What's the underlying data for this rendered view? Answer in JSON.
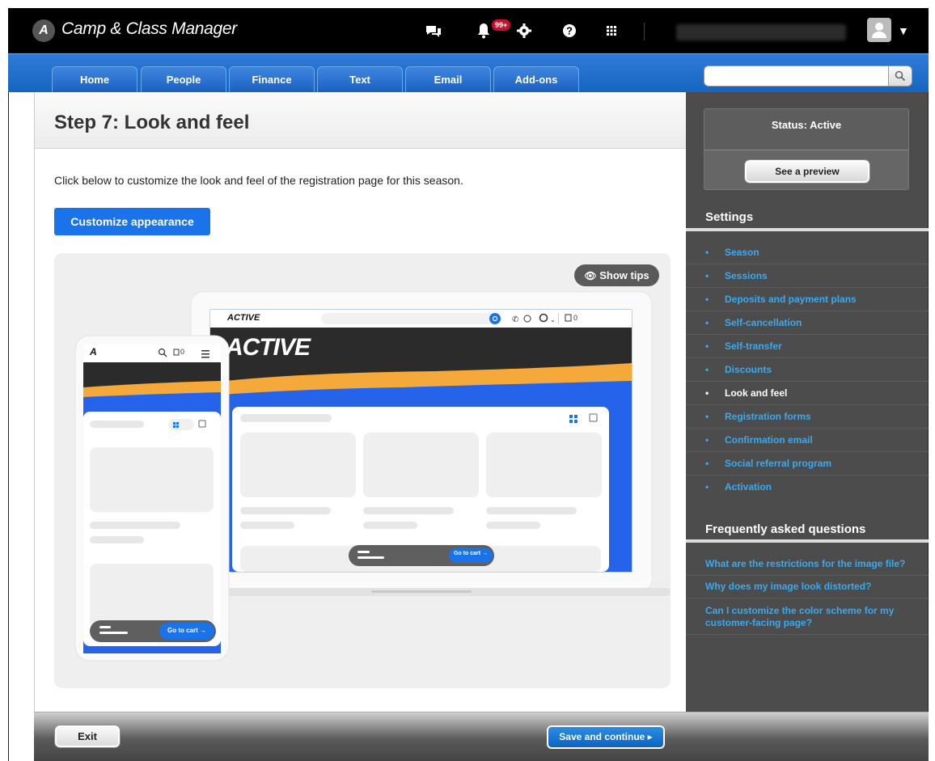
{
  "app": {
    "title": "Camp & Class Manager",
    "logo_glyph": "A",
    "notification_count": "99+"
  },
  "topbar_icons": [
    "chat-icon",
    "bell-icon",
    "gear-icon",
    "help-icon",
    "apps-grid-icon",
    "user-avatar-icon",
    "caret-down-icon"
  ],
  "nav": {
    "tabs": [
      {
        "label": "Home"
      },
      {
        "label": "People"
      },
      {
        "label": "Finance"
      },
      {
        "label": "Text"
      },
      {
        "label": "Email"
      },
      {
        "label": "Add-ons"
      }
    ],
    "search_placeholder": ""
  },
  "main": {
    "title": "Step 7: Look and feel",
    "intro": "Click below to customize the look and feel of the registration page for this season.",
    "customize_button": "Customize appearance",
    "show_tips": "Show tips",
    "preview": {
      "desktop_brand": "ACTIVE",
      "desktop_hero_brand": "ACTIVE",
      "desktop_cart_count": "0",
      "desktop_go_to_cart": "Go to cart →",
      "mobile_cart_count": "0",
      "mobile_go_to_cart": "Go to cart →"
    }
  },
  "footer": {
    "exit_label": "Exit",
    "save_label": "Save and continue ▸"
  },
  "sidebar": {
    "status": "Status: Active",
    "preview_button": "See a preview",
    "settings_heading": "Settings",
    "settings_items": [
      {
        "label": "Season",
        "current": false
      },
      {
        "label": "Sessions",
        "current": false
      },
      {
        "label": "Deposits and payment plans",
        "current": false
      },
      {
        "label": "Self-cancellation",
        "current": false
      },
      {
        "label": "Self-transfer",
        "current": false
      },
      {
        "label": "Discounts",
        "current": false
      },
      {
        "label": "Look and feel",
        "current": true
      },
      {
        "label": "Registration forms",
        "current": false
      },
      {
        "label": "Confirmation email",
        "current": false
      },
      {
        "label": "Social referral program",
        "current": false
      },
      {
        "label": "Activation",
        "current": false
      }
    ],
    "faq_heading": "Frequently asked questions",
    "faq_items": [
      {
        "label": "What are the restrictions for the image file?"
      },
      {
        "label": "Why does my image look distorted?"
      },
      {
        "label": "Can I customize the color scheme for my customer-facing page?"
      }
    ]
  },
  "colors": {
    "nav_blue": "#1565c0",
    "link_blue": "#3aaaf0",
    "button_blue": "#1a73e8",
    "hero_orange": "#f5a93b",
    "hero_blue": "#2563eb",
    "sidebar_bg": "#4c4c4c"
  }
}
